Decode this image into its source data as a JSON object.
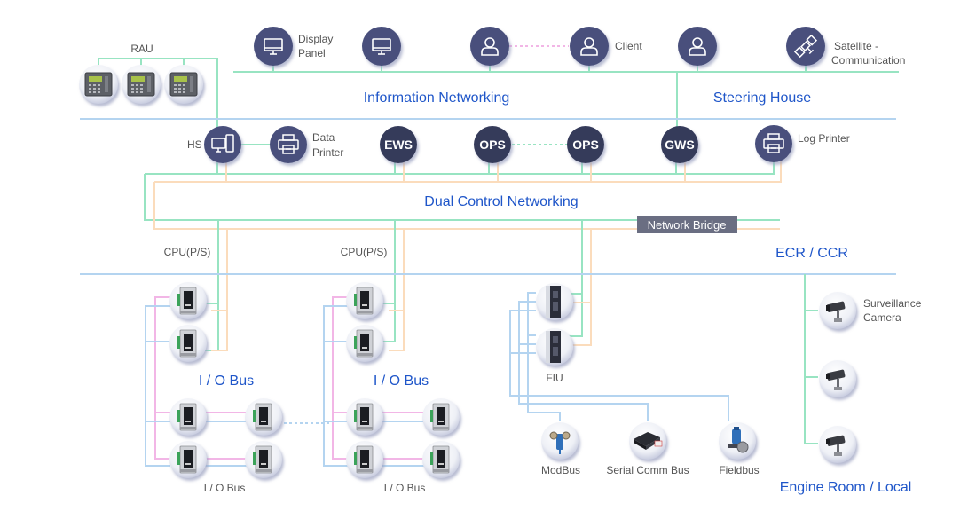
{
  "colors": {
    "green": "#98e4c2",
    "orange": "#fbdcbc",
    "blue": "#b4d4f0",
    "pink": "#f2b6e6",
    "dark_node": "#353a5a",
    "icon_node": "#48507c",
    "section_text": "#1f56c9",
    "bridge": "#6a6e82"
  },
  "sections": {
    "information": "Information Networking",
    "steering": "Steering House",
    "dual_control": "Dual Control Networking",
    "ecr_ccr": "ECR / CCR",
    "engine_room": "Engine Room / Local",
    "io_bus_1": "I / O Bus",
    "io_bus_2": "I / O Bus"
  },
  "labels": {
    "rau": "RAU",
    "display_panel_line1": "Display",
    "display_panel_line2": "Panel",
    "client": "Client",
    "satellite_line1": "Satellite -",
    "satellite_line2": "Communication",
    "hs": "HS",
    "data_printer_line1": "Data",
    "data_printer_line2": "Printer",
    "log_printer": "Log Printer",
    "network_bridge": "Network Bridge",
    "cpu_1": "CPU(P/S)",
    "cpu_2": "CPU(P/S)",
    "fiu": "FIU",
    "io_bus_small_1": "I / O Bus",
    "io_bus_small_2": "I / O Bus",
    "modbus": "ModBus",
    "serial_comm_bus": "Serial Comm Bus",
    "fieldbus": "Fieldbus",
    "surveillance_line1": "Surveillance",
    "surveillance_line2": "Camera"
  },
  "nodes": {
    "ews": "EWS",
    "ops_1": "OPS",
    "ops_2": "OPS",
    "gws": "GWS"
  },
  "icons": {
    "display_panel": "monitor-icon",
    "monitor": "monitor-icon",
    "user": "user-icon",
    "satellite": "satellite-icon",
    "hs": "workstation-icon",
    "printer": "printer-icon",
    "rau": "remote-access-unit-icon",
    "io_module": "io-module-icon",
    "fiu": "fieldbus-interface-unit-icon",
    "camera": "surveillance-camera-icon",
    "modbus": "modbus-device-icon",
    "serial": "serial-comm-device-icon",
    "fieldbus": "fieldbus-valve-icon"
  }
}
